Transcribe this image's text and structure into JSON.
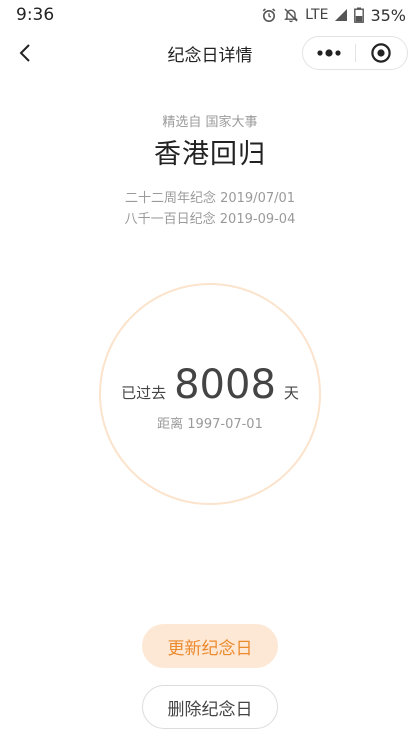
{
  "status_bar": {
    "time": "9:36",
    "network": "LTE",
    "battery": "35%"
  },
  "nav": {
    "title": "纪念日详情"
  },
  "event": {
    "source": "精选自 国家大事",
    "title": "香港回归",
    "milestones": [
      "二十二周年纪念 2019/07/01",
      "八千一百日纪念 2019-09-04"
    ]
  },
  "counter": {
    "prefix": "已过去",
    "days": "8008",
    "unit": "天",
    "since": "距离 1997-07-01"
  },
  "actions": {
    "update_label": "更新纪念日",
    "delete_label": "删除纪念日"
  },
  "colors": {
    "accent": "#ec8a2e",
    "accent_bg": "#fde8d6",
    "circle_border": "#fbe3cc"
  }
}
